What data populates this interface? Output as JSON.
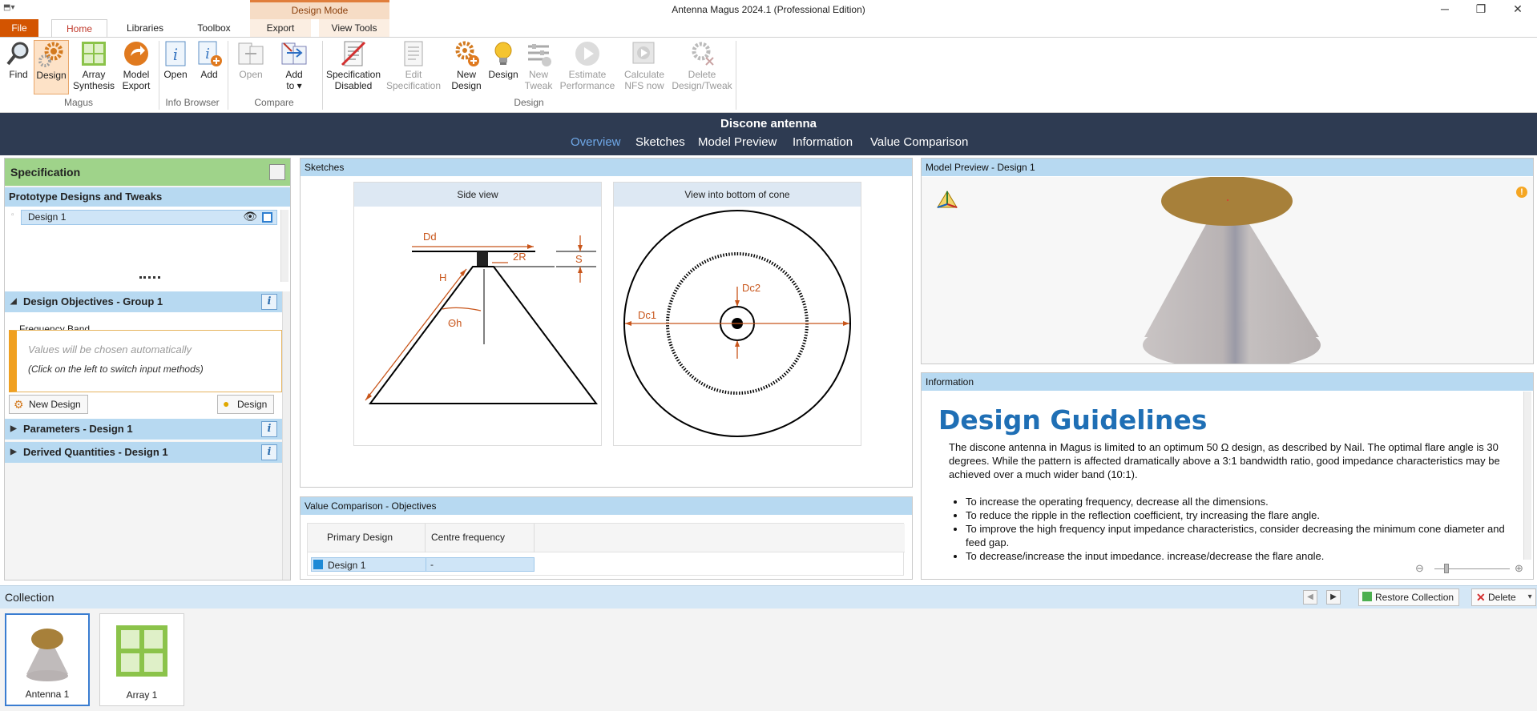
{
  "window": {
    "title": "Antenna Magus 2024.1 (Professional Edition)",
    "context_group": "Design Mode"
  },
  "ribbon_tabs": {
    "file": "File",
    "home": "Home",
    "libraries": "Libraries",
    "toolbox": "Toolbox",
    "export": "Export",
    "view_tools": "View Tools"
  },
  "ribbon": {
    "find": "Find",
    "design": "Design",
    "array_synthesis": [
      "Array",
      "Synthesis"
    ],
    "model_export": [
      "Model",
      "Export"
    ],
    "open_info": "Open",
    "add_info": "Add",
    "open_compare": "Open",
    "add_to": [
      "Add",
      "to ▾"
    ],
    "spec_disabled": [
      "Specification",
      "Disabled"
    ],
    "edit_spec": [
      "Edit",
      "Specification"
    ],
    "new_design": [
      "New",
      "Design"
    ],
    "design2": "Design",
    "new_tweak": [
      "New",
      "Tweak"
    ],
    "estimate_perf": [
      "Estimate",
      "Performance"
    ],
    "calc_nfs": [
      "Calculate",
      "NFS now"
    ],
    "delete_design": [
      "Delete",
      "Design/Tweak"
    ],
    "groups": {
      "magus": "Magus",
      "info_browser": "Info Browser",
      "compare": "Compare",
      "design": "Design"
    }
  },
  "header": {
    "antenna_name": "Discone antenna",
    "nav": [
      "Overview",
      "Sketches",
      "Model Preview",
      "Information",
      "Value Comparison"
    ]
  },
  "spec": {
    "title": "Specification",
    "prototypes_title": "Prototype Designs and Tweaks",
    "design_item": "Design 1",
    "objectives": "Design Objectives  -  Group 1",
    "freq_band_label": "Frequency Band",
    "auto_text": "Values will be chosen automatically",
    "click_hint": "(Click on the left to switch input methods)",
    "new_design_btn": "New Design",
    "design_btn": "Design",
    "parameters": "Parameters  -  Design 1",
    "derived": "Derived Quantities  -  Design 1"
  },
  "sketches": {
    "title": "Sketches",
    "side_view": "Side view",
    "bottom_view": "View into bottom of cone",
    "labels": {
      "dd": "Dd",
      "two_r": "2R",
      "s": "S",
      "h": "H",
      "theta_h": "Θh",
      "dc1": "Dc1",
      "dc2": "Dc2"
    }
  },
  "value_comparison": {
    "title": "Value Comparison - Objectives",
    "columns": [
      "Primary Design",
      "Centre frequency"
    ],
    "row_name": "Design 1",
    "row_value": "-"
  },
  "preview": {
    "title": "Model Preview  -  Design 1"
  },
  "information": {
    "title": "Information",
    "heading": "Design Guidelines",
    "paragraph": "The discone antenna in Magus is limited to an optimum 50 Ω design, as described by Nail. The optimal flare angle is 30 degrees. While the pattern is affected dramatically above a 3:1 bandwidth ratio, good impedance characteristics may be achieved over a much wider band (10:1).",
    "bullets": [
      "To increase the operating frequency, decrease all the dimensions.",
      "To reduce the ripple in the reflection coefficient, try increasing the flare angle.",
      "To improve the high frequency input impedance characteristics, consider decreasing the minimum cone diameter and feed gap.",
      "To decrease/increase the input impedance, increase/decrease the flare angle."
    ]
  },
  "collection": {
    "title": "Collection",
    "restore": "Restore Collection",
    "delete": "Delete",
    "items": [
      "Antenna 1",
      "Array 1"
    ]
  },
  "colors": {
    "accent_orange": "#d35400",
    "dark_header": "#2e3b52",
    "panel_blue": "#b7d9f1",
    "spec_green": "#9fd38a",
    "sketch_orange": "#c8551a"
  }
}
